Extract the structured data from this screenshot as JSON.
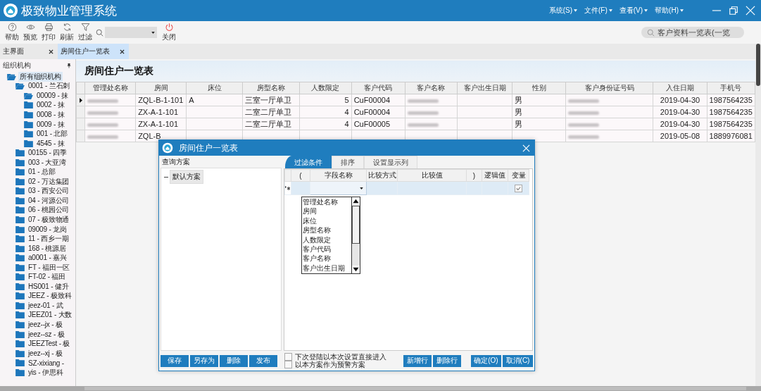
{
  "window": {
    "title": "极致物业管理系统"
  },
  "menu": [
    "系统(S)",
    "文件(F)",
    "查看(V)",
    "帮助(H)"
  ],
  "toolbar": [
    {
      "kind": "help",
      "label": "帮助"
    },
    {
      "kind": "preview",
      "label": "预览"
    },
    {
      "kind": "print",
      "label": "打印"
    },
    {
      "kind": "refresh",
      "label": "刷新"
    },
    {
      "kind": "filter",
      "label": "过滤"
    },
    {
      "kind": "combo"
    },
    {
      "kind": "close",
      "label": "关闭"
    }
  ],
  "global_search": {
    "value": "客户资料一览表(一览"
  },
  "tabs": [
    {
      "label": "主界面",
      "selected": false
    },
    {
      "label": "房间住户一览表",
      "selected": true
    }
  ],
  "sidebar": {
    "title": "组织机构",
    "tree": [
      {
        "label": "所有组织机构",
        "expanded": true,
        "selected": true,
        "children": [
          {
            "label": "0001 - 兰石刺",
            "expanded": true,
            "selected": false,
            "children": [
              {
                "label": "00009 - 抹",
                "expanded": true,
                "selected": false
              },
              {
                "label": "0002 - 抹",
                "expanded": false,
                "selected": false
              },
              {
                "label": "0008 - 抹",
                "expanded": false,
                "selected": false
              },
              {
                "label": "0009 - 抹",
                "expanded": false,
                "selected": false
              },
              {
                "label": "001 - 北部",
                "expanded": false,
                "selected": false
              },
              {
                "label": "4545 - 抹",
                "expanded": false,
                "selected": false
              }
            ]
          },
          {
            "label": "00155 - 四季",
            "expanded": false,
            "selected": false
          },
          {
            "label": "003 - 大亚湾",
            "expanded": false,
            "selected": false
          },
          {
            "label": "01 - 总部",
            "expanded": false,
            "selected": false
          },
          {
            "label": "02 - 万达集团",
            "expanded": false,
            "selected": false
          },
          {
            "label": "03 - 西安公司",
            "expanded": false,
            "selected": false
          },
          {
            "label": "04 - 河源公司",
            "expanded": false,
            "selected": false
          },
          {
            "label": "06 - 桃园公司",
            "expanded": false,
            "selected": false
          },
          {
            "label": "07 - 极致物通",
            "expanded": false,
            "selected": false
          },
          {
            "label": "09009 - 龙岗",
            "expanded": false,
            "selected": false
          },
          {
            "label": "11 - 西乡一期",
            "expanded": false,
            "selected": false
          },
          {
            "label": "168 - 桃源居",
            "expanded": false,
            "selected": false
          },
          {
            "label": "a0001 - 嘉兴",
            "expanded": false,
            "selected": false
          },
          {
            "label": "FT - 福田一区",
            "expanded": false,
            "selected": false
          },
          {
            "label": "FT-02 - 福田",
            "expanded": false,
            "selected": false
          },
          {
            "label": "HS001 - 健升",
            "expanded": false,
            "selected": false
          },
          {
            "label": "JEEZ - 极致科",
            "expanded": false,
            "selected": false
          },
          {
            "label": "jeez-01 - 武",
            "expanded": false,
            "selected": false
          },
          {
            "label": "JEEZ01 - 大数",
            "expanded": false,
            "selected": false
          },
          {
            "label": "jeez--jx - 极",
            "expanded": false,
            "selected": false
          },
          {
            "label": "jeez--sz - 极",
            "expanded": false,
            "selected": false
          },
          {
            "label": "JEEZTest - 极",
            "expanded": false,
            "selected": false
          },
          {
            "label": "jeez--xj - 极",
            "expanded": false,
            "selected": false
          },
          {
            "label": "SZ-xixiang -",
            "expanded": false,
            "selected": false
          },
          {
            "label": "yis - 伊思科",
            "expanded": false,
            "selected": false
          }
        ]
      }
    ]
  },
  "page": {
    "title": "房间住户一览表"
  },
  "table": {
    "columns": [
      {
        "label": "管理处名称"
      },
      {
        "label": "房间"
      },
      {
        "label": "床位"
      },
      {
        "label": "房型名称"
      },
      {
        "label": "人数限定",
        "kind": "number"
      },
      {
        "label": "客户代码"
      },
      {
        "label": "客户名称"
      },
      {
        "label": "客户出生日期"
      },
      {
        "label": "性别"
      },
      {
        "label": "客户身份证号码"
      },
      {
        "label": "入住日期",
        "kind": "date"
      },
      {
        "label": "手机号"
      }
    ],
    "rows": [
      {
        "current": true,
        "cells": [
          {
            "kind": "redacted"
          },
          "ZQL-B-1-101",
          "A",
          "三室一厅单卫",
          "5",
          "CuF00004",
          {
            "kind": "redacted"
          },
          null,
          "男",
          {
            "kind": "redacted"
          },
          "2019-04-30",
          "1987564235"
        ]
      },
      {
        "current": false,
        "cells": [
          {
            "kind": "redacted"
          },
          "ZX-A-1-101",
          null,
          "二室二厅单卫",
          "4",
          "CuF00004",
          {
            "kind": "redacted"
          },
          null,
          "男",
          {
            "kind": "redacted"
          },
          "2019-04-30",
          "1987564235"
        ]
      },
      {
        "current": false,
        "cells": [
          {
            "kind": "redacted"
          },
          "ZX-A-1-101",
          null,
          "二室二厅单卫",
          "4",
          "CuF00005",
          {
            "kind": "redacted"
          },
          null,
          "男",
          {
            "kind": "redacted"
          },
          "2019-04-30",
          "1987564235"
        ]
      },
      {
        "current": false,
        "cells": [
          {
            "kind": "redacted"
          },
          "ZQL-B",
          null,
          null,
          null,
          null,
          null,
          null,
          null,
          {
            "kind": "redacted"
          },
          "2019-05-08",
          "1889976081"
        ]
      }
    ]
  },
  "dialog": {
    "title": "房间住户一览表",
    "schemes": {
      "title": "查询方案",
      "items": [
        {
          "label": "默认方案"
        }
      ]
    },
    "tabs": [
      {
        "label": "过滤条件",
        "selected": true
      },
      {
        "label": "排序",
        "selected": false
      },
      {
        "label": "设置显示列",
        "selected": false
      }
    ],
    "filter_grid": {
      "columns": [
        "(",
        "字段名称",
        "比较方式",
        "比较值",
        ")",
        "逻辑值",
        "变量"
      ],
      "rows": [
        {
          "new": true,
          "variable": true
        }
      ]
    },
    "field_dropdown": {
      "options": [
        "管理处名称",
        "房间",
        "床位",
        "房型名称",
        "人数限定",
        "客户代码",
        "客户名称",
        "客户出生日期"
      ]
    },
    "scheme_buttons": [
      "保存",
      "另存为",
      "删除",
      "发布"
    ],
    "options": [
      {
        "label": "下次登陆以本次设置直接进入",
        "checked": false
      },
      {
        "label": "以本方案作为预警方案",
        "checked": false
      }
    ],
    "row_buttons": [
      "新增行",
      "删除行"
    ],
    "buttons": [
      "确定(O)",
      "取消(C)"
    ]
  }
}
